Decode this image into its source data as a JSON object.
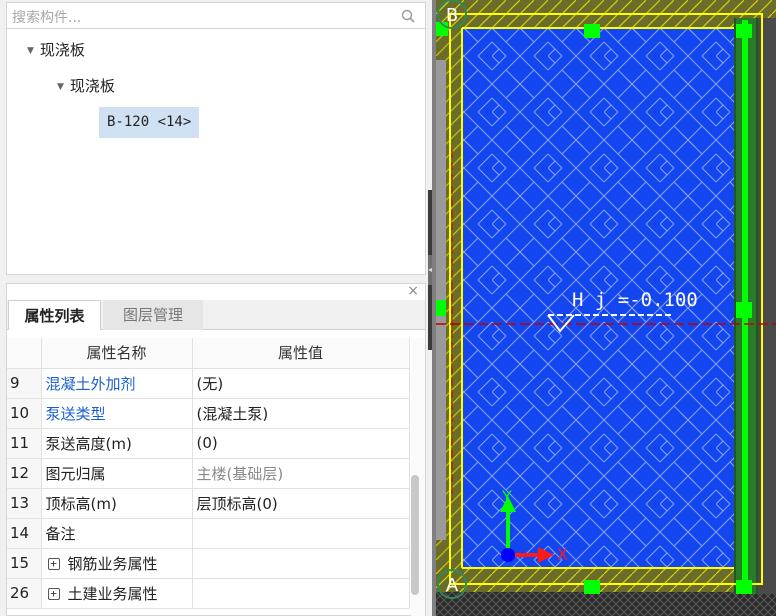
{
  "search": {
    "placeholder": "搜索构件..."
  },
  "tree": {
    "root": {
      "label": "现浇板"
    },
    "child": {
      "label": "现浇板"
    },
    "leaf": {
      "label": "B-120 <14>"
    }
  },
  "panel": {
    "close": "×",
    "tabs": {
      "properties": "属性列表",
      "layers": "图层管理"
    },
    "columns": {
      "name": "属性名称",
      "value": "属性值"
    },
    "rows": [
      {
        "num": "9",
        "name": "混凝土外加剂",
        "value": "(无)",
        "blue": true
      },
      {
        "num": "10",
        "name": "泵送类型",
        "value": "(混凝土泵)",
        "blue": true
      },
      {
        "num": "11",
        "name": "泵送高度(m)",
        "value": "(0)"
      },
      {
        "num": "12",
        "name": "图元归属",
        "value": "主楼(基础层)",
        "grayValue": true
      },
      {
        "num": "13",
        "name": "顶标高(m)",
        "value": "层顶标高(0)"
      },
      {
        "num": "14",
        "name": "备注",
        "value": ""
      },
      {
        "num": "15",
        "name": "钢筋业务属性",
        "value": "",
        "expandable": true
      },
      {
        "num": "26",
        "name": "土建业务属性",
        "value": "",
        "expandable": true
      }
    ]
  },
  "canvas": {
    "axis_top": "B",
    "axis_bottom": "A",
    "annotation": "H j =-0.100",
    "ucs_x": "X",
    "ucs_y": "Y",
    "colors": {
      "slab_fill": "#1446f0",
      "hatch": "#8fa8ff",
      "beam_green": "#00ff00",
      "beam_yellow": "#ffff00",
      "axis_red": "#c00000",
      "background": "#222222"
    }
  }
}
